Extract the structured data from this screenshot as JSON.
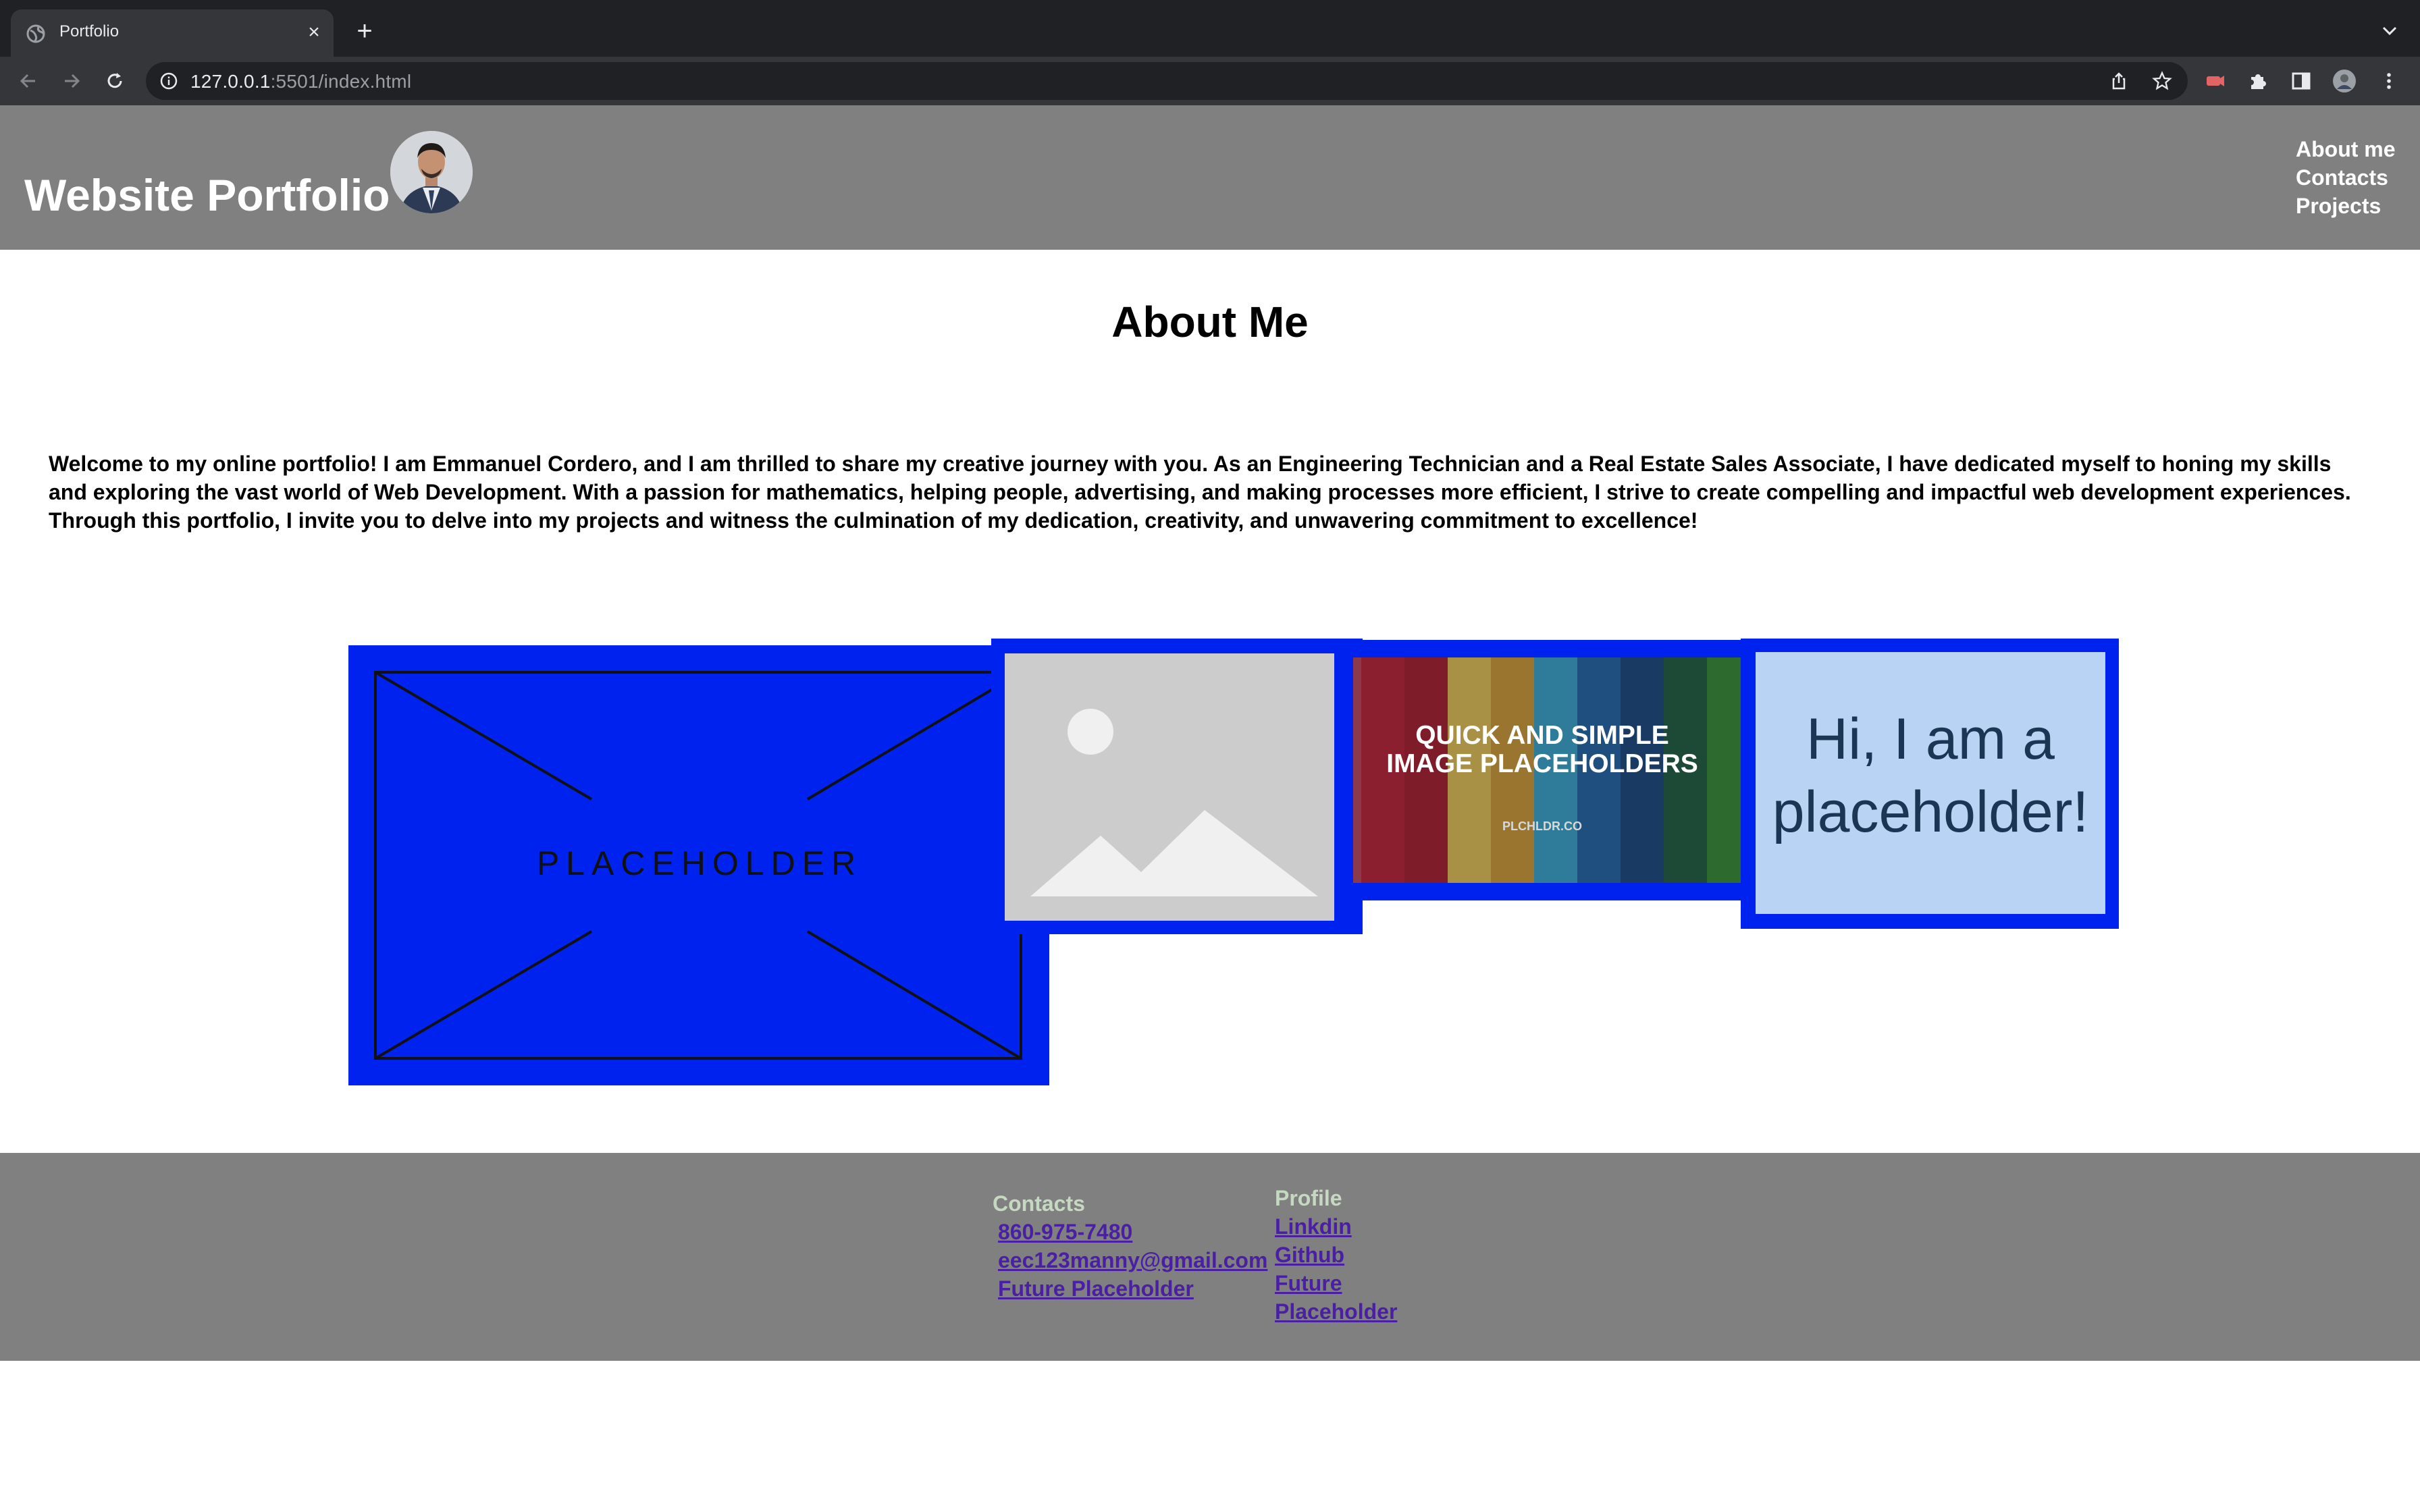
{
  "browser": {
    "tab_title": "Portfolio",
    "url_host": "127.0.0.1",
    "url_rest": ":5501/index.html"
  },
  "header": {
    "title": "Website Portfolio",
    "nav": [
      "About me",
      "Contacts",
      "Projects"
    ]
  },
  "about": {
    "heading": "About Me",
    "text": "Welcome to my online portfolio! I am Emmanuel Cordero, and I am thrilled to share my creative journey with you. As an Engineering Technician and a Real Estate Sales Associate, I have dedicated myself to honing my skills and exploring the vast world of Web Development. With a passion for mathematics, helping people, advertising, and making processes more efficient, I strive to create compelling and impactful web development experiences. Through this portfolio, I invite you to delve into my projects and witness the culmination of my dedication, creativity, and unwavering commitment to excellence!"
  },
  "images": {
    "img1_text": "PLACEHOLDER",
    "img3_line1": "QUICK AND SIMPLE",
    "img3_line2": "IMAGE PLACEHOLDERS",
    "img3_site": "PLCHLDR.CO",
    "img4_line1": "Hi, I am a",
    "img4_line2": "placeholder!"
  },
  "footer": {
    "contacts_heading": "Contacts",
    "contacts": [
      "860-975-7480",
      "eec123manny@gmail.com",
      "Future Placeholder"
    ],
    "profile_heading": "Profile",
    "profile": [
      "Linkdin",
      "Github",
      "Future",
      "Placeholder"
    ]
  },
  "colors": {
    "header_bg": "#808080",
    "image_border": "#0022ee",
    "footer_heading": "#c5d9c0",
    "footer_link": "#4b1fa3"
  }
}
